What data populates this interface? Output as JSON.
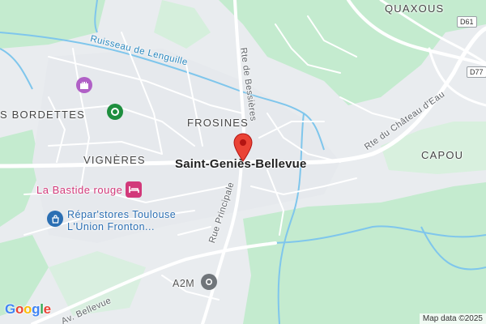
{
  "map": {
    "places": {
      "quaxous": "QUAXOUS",
      "bordettes": "S BORDETTES",
      "frosines": "FROSINES",
      "vigneres": "VIGNÈRES",
      "capou": "CAPOU",
      "main_town": "Saint-Geniès-Bellevue"
    },
    "roads": {
      "rte_bessieres": "Rte de Bessières",
      "rte_chateau": "Rte du Château d'Eau",
      "rue_principale": "Rue Principale",
      "av_bellevue": "Av. Bellevue"
    },
    "water": {
      "ruisseau": "Ruisseau de Lenguille"
    },
    "shields": {
      "d61": "D61",
      "d77": "D77"
    },
    "pois": {
      "bastide": "La Bastide rouge",
      "repar_line1": "Répar'stores Toulouse",
      "repar_line2": "L'Union Fronton...",
      "a2m": "A2M"
    },
    "icons": {
      "marker": "map-pin-icon",
      "castle": "castle-icon",
      "park": "park-icon",
      "hotel": "bed-icon",
      "shop": "shopping-bag-icon",
      "business": "business-icon"
    },
    "colors": {
      "land": "#e9ecef",
      "green": "#c4ebcf",
      "water": "#7fc6ec",
      "road": "#ffffff",
      "marker": "#ea4335",
      "poi_pink": "#d2397a",
      "poi_blue": "#2b6fb3",
      "poi_green": "#1e8e3e"
    }
  },
  "footer": {
    "logo": "Google",
    "attribution": "Map data ©2025"
  }
}
